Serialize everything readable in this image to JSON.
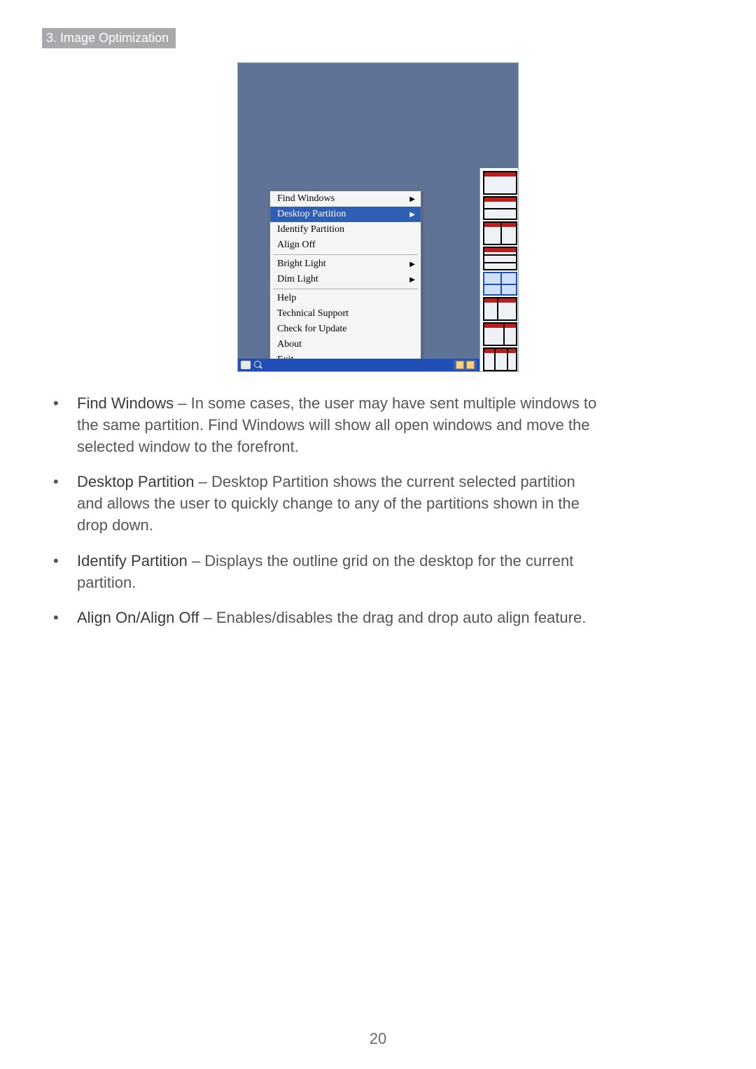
{
  "section_label": "3. Image Optimization",
  "context_menu": {
    "items": [
      {
        "label": "Find Windows",
        "arrow": true,
        "selected": false
      },
      {
        "label": "Desktop Partition",
        "arrow": true,
        "selected": true
      },
      {
        "label": "Identify Partition",
        "arrow": false,
        "selected": false
      },
      {
        "label": "Align Off",
        "arrow": false,
        "selected": false
      },
      {
        "sep": true
      },
      {
        "label": "Bright Light",
        "arrow": true,
        "selected": false
      },
      {
        "label": "Dim Light",
        "arrow": true,
        "selected": false
      },
      {
        "sep": true
      },
      {
        "label": "Help",
        "arrow": false,
        "selected": false
      },
      {
        "label": "Technical Support",
        "arrow": false,
        "selected": false
      },
      {
        "label": "Check for Update",
        "arrow": false,
        "selected": false
      },
      {
        "label": "About",
        "arrow": false,
        "selected": false
      },
      {
        "label": "Exit",
        "arrow": false,
        "selected": false
      }
    ]
  },
  "bullets": [
    {
      "bold": "Find Windows",
      "text": " – In some cases, the user may have sent multiple windows to the same partition.  Find Windows will show all open windows and move the selected window to the forefront."
    },
    {
      "bold": "Desktop Partition",
      "text": " – Desktop Partition shows the current selected partition and allows the user to quickly change to any of the partitions shown in the drop down."
    },
    {
      "bold": "Identify Partition",
      "text": " – Displays the outline grid on the desktop for the current parti­tion."
    },
    {
      "bold": "Align On/Align Off",
      "text": " – Enables/disables the drag and drop auto align feature."
    }
  ],
  "page_number": "20"
}
